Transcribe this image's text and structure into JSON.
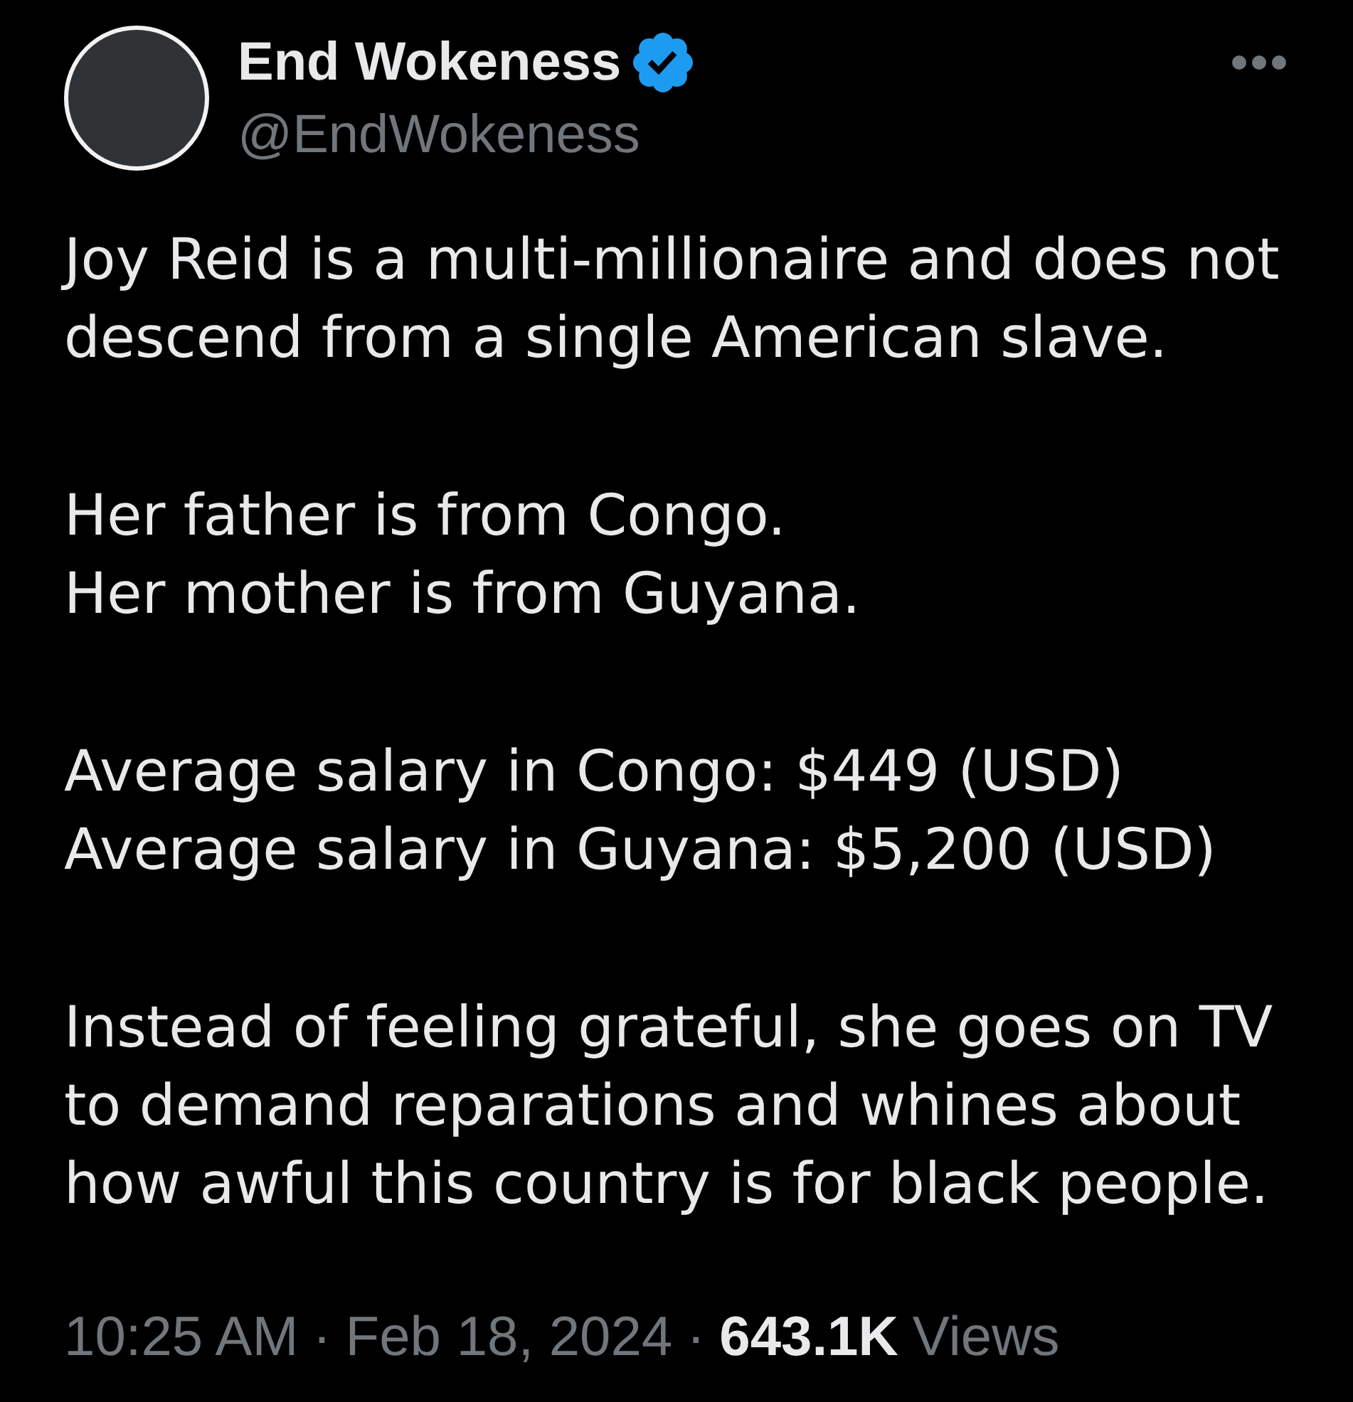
{
  "author": {
    "name": "End Wokeness",
    "verified": true,
    "handle": "@EndWokeness"
  },
  "body": {
    "paragraphs": [
      {
        "lines": [
          "Joy Reid is a multi-millionaire and does not",
          "descend from a single American slave."
        ]
      },
      {
        "lines": [
          "Her father is from Congo.",
          "Her mother is from Guyana."
        ]
      },
      {
        "lines": [
          "Average salary in Congo: $449 (USD)",
          "Average salary in Guyana: $5,200 (USD)"
        ]
      },
      {
        "lines": [
          "Instead of feeling grateful, she goes on TV",
          "to demand reparations and whines about",
          "how awful this country is for black people."
        ]
      }
    ]
  },
  "meta": [
    {
      "kind": "time",
      "text": "10:25 AM"
    },
    {
      "kind": "dot",
      "text": "·"
    },
    {
      "kind": "date",
      "text": "Feb 18, 2024"
    },
    {
      "kind": "dot",
      "text": "·"
    },
    {
      "kind": "count",
      "text": "643.1K"
    },
    {
      "kind": "label",
      "text": "Views"
    }
  ]
}
